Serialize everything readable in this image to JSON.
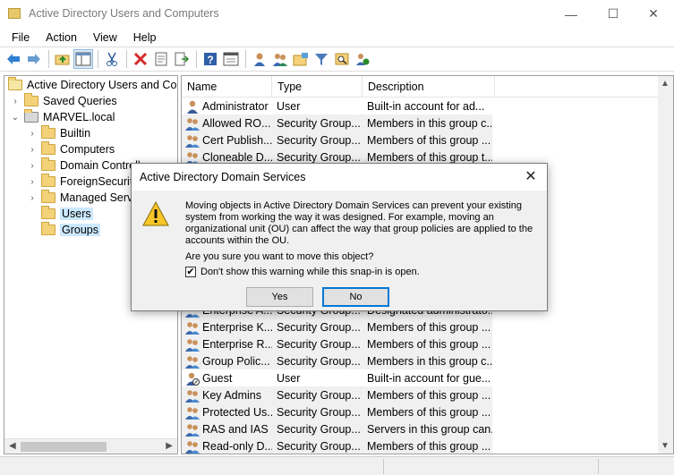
{
  "window": {
    "title": "Active Directory Users and Computers",
    "minimize": "—",
    "maximize": "☐",
    "close": "✕"
  },
  "menu": [
    "File",
    "Action",
    "View",
    "Help"
  ],
  "tree": {
    "items": [
      {
        "label": "Active Directory Users and Com",
        "indent": 0,
        "expander": ""
      },
      {
        "label": "Saved Queries",
        "indent": 1,
        "expander": "›"
      },
      {
        "label": "MARVEL.local",
        "indent": 1,
        "expander": "⌄"
      },
      {
        "label": "Builtin",
        "indent": 2,
        "expander": "›"
      },
      {
        "label": "Computers",
        "indent": 2,
        "expander": "›"
      },
      {
        "label": "Domain Controll",
        "indent": 2,
        "expander": "›"
      },
      {
        "label": "ForeignSecurity",
        "indent": 2,
        "expander": "›"
      },
      {
        "label": "Managed Servi",
        "indent": 2,
        "expander": "›"
      },
      {
        "label": "Users",
        "indent": 2,
        "expander": "",
        "state": "selected"
      },
      {
        "label": "Groups",
        "indent": 2,
        "expander": "",
        "state": "highlight"
      }
    ]
  },
  "list": {
    "columns": [
      "Name",
      "Type",
      "Description"
    ],
    "rows": [
      {
        "name": "Administrator",
        "type": "User",
        "desc": "Built-in account for ad...",
        "icon": "user-icon",
        "plain": true
      },
      {
        "name": "Allowed RO...",
        "type": "Security Group...",
        "desc": "Members in this group c...",
        "icon": "group-icon"
      },
      {
        "name": "Cert Publish...",
        "type": "Security Group...",
        "desc": "Members of this group ...",
        "icon": "group-icon"
      },
      {
        "name": "Cloneable D...",
        "type": "Security Group...",
        "desc": "Members of this group t...",
        "icon": "group-icon"
      },
      {
        "name": "Enterprise A...",
        "type": "Security Group...",
        "desc": "Designated administrato...",
        "icon": "group-icon"
      },
      {
        "name": "Enterprise K...",
        "type": "Security Group...",
        "desc": "Members of this group ...",
        "icon": "group-icon"
      },
      {
        "name": "Enterprise R...",
        "type": "Security Group...",
        "desc": "Members of this group ...",
        "icon": "group-icon"
      },
      {
        "name": "Group Polic...",
        "type": "Security Group...",
        "desc": "Members in this group c...",
        "icon": "group-icon"
      },
      {
        "name": "Guest",
        "type": "User",
        "desc": "Built-in account for gue...",
        "icon": "user-disabled-icon",
        "plain": true
      },
      {
        "name": "Key Admins",
        "type": "Security Group...",
        "desc": "Members of this group ...",
        "icon": "group-icon"
      },
      {
        "name": "Protected Us...",
        "type": "Security Group...",
        "desc": "Members of this group ...",
        "icon": "group-icon"
      },
      {
        "name": "RAS and IAS ...",
        "type": "Security Group...",
        "desc": "Servers in this group can...",
        "icon": "group-icon"
      },
      {
        "name": "Read-only D...",
        "type": "Security Group...",
        "desc": "Members of this group ...",
        "icon": "group-icon"
      }
    ]
  },
  "dialog": {
    "title": "Active Directory Domain Services",
    "message": "Moving objects in Active Directory Domain Services can prevent your existing system from working the way it was designed. For example, moving an organizational unit (OU) can affect the way that group policies are applied to the accounts within the OU.",
    "question": "Are you sure you want to move this object?",
    "checkbox_label": "Don't show this warning while this snap-in is open.",
    "checkbox_checked": true,
    "checkbox_mark": "✔",
    "yes_label": "Yes",
    "no_label": "No",
    "close": "✕"
  },
  "colors": {
    "accent": "#0078d7",
    "selection": "#cce8ff",
    "folder": "#f3d27a"
  }
}
